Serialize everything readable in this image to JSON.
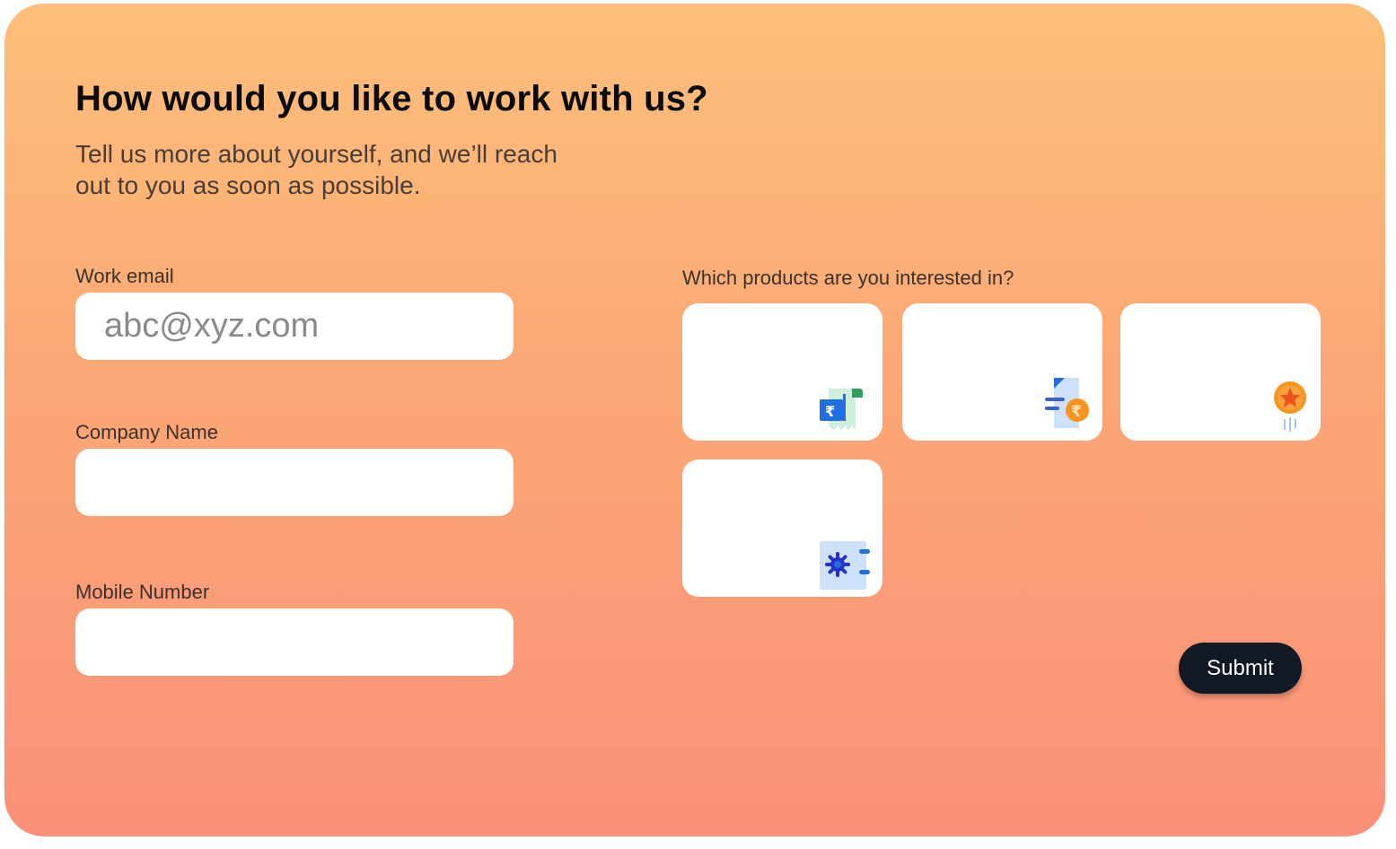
{
  "form": {
    "heading": "How would you like to work with us?",
    "subtitle": "Tell us more about yourself, and we’ll reach out to you as soon as possible.",
    "fields": [
      {
        "label": "Work email",
        "value": "",
        "placeholder": "abc@xyz.com"
      },
      {
        "label": "Company Name",
        "value": "",
        "placeholder": ""
      },
      {
        "label": "Mobile Number",
        "value": "",
        "placeholder": ""
      }
    ],
    "products": {
      "label": "Which products are you interested in?",
      "options": [
        {
          "icon": "rupee-receipt-icon"
        },
        {
          "icon": "rupee-document-icon"
        },
        {
          "icon": "star-medal-icon"
        },
        {
          "icon": "settings-panel-icon"
        }
      ]
    },
    "submit_label": "Submit"
  },
  "colors": {
    "gradient_top": "#fdc07b",
    "gradient_bottom": "#fa917a",
    "submit_bg": "#111a24",
    "icon_blue": "#1f6fe0",
    "icon_orange": "#f7941d",
    "icon_green": "#2e9e5b"
  }
}
